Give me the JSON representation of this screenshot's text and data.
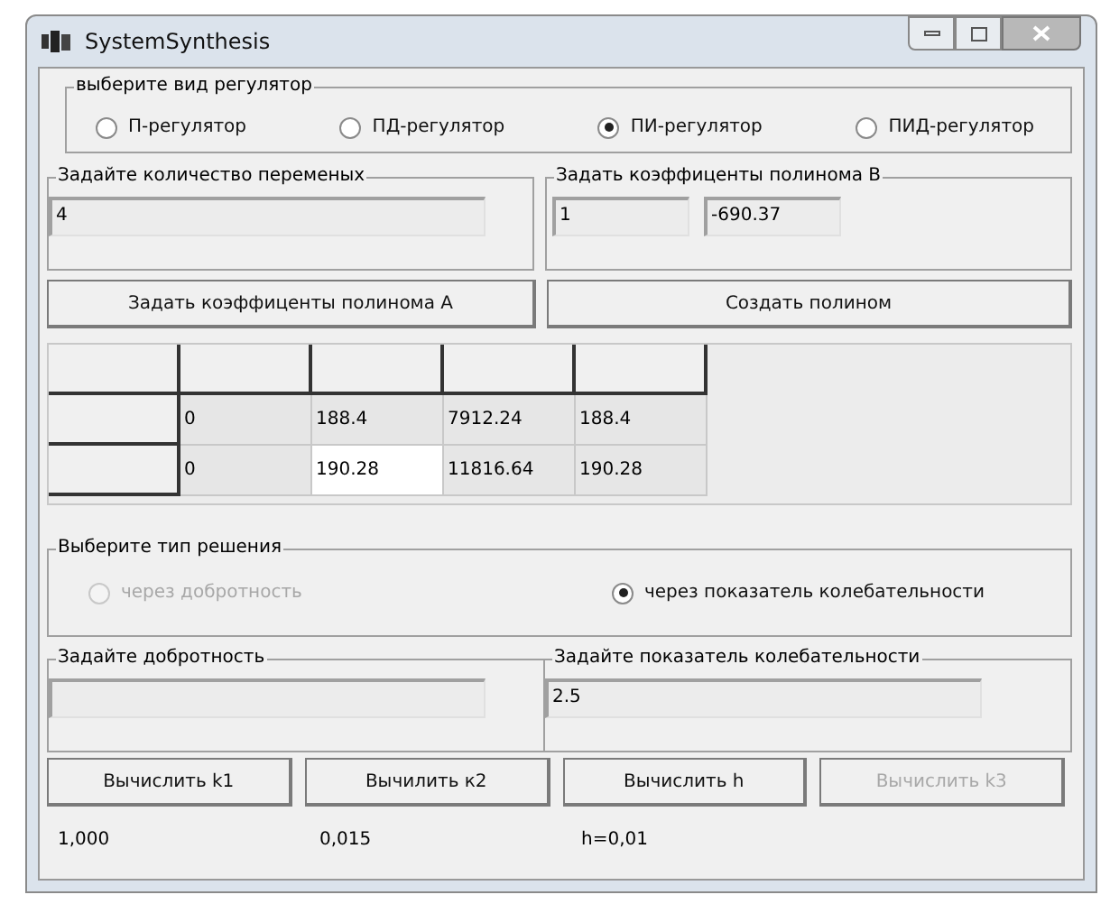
{
  "window": {
    "title": "SystemSynthesis"
  },
  "regulator": {
    "legend": "выберите вид регулятор",
    "options": [
      {
        "label": "П-регулятор",
        "selected": false
      },
      {
        "label": "ПД-регулятор",
        "selected": false
      },
      {
        "label": "ПИ-регулятор",
        "selected": true
      },
      {
        "label": "ПИД-регулятор",
        "selected": false
      }
    ]
  },
  "variables": {
    "legend": "Задайте количество переменых",
    "value": "4"
  },
  "poly_b": {
    "legend": "Задать коэффиценты полинома B",
    "values": [
      "1",
      "-690.37"
    ]
  },
  "top_buttons": [
    "Задать коэффиценты полинома A",
    "Создать полином"
  ],
  "table": {
    "rows": [
      {
        "cells": [
          {
            "text": "0",
            "selected": false
          },
          {
            "text": "188.4",
            "selected": false
          },
          {
            "text": "7912.24",
            "selected": false
          },
          {
            "text": "188.4",
            "selected": false
          }
        ]
      },
      {
        "cells": [
          {
            "text": "0",
            "selected": false
          },
          {
            "text": "190.28",
            "selected": true
          },
          {
            "text": "11816.64",
            "selected": false
          },
          {
            "text": "190.28",
            "selected": false
          }
        ]
      }
    ]
  },
  "solution": {
    "legend": "Выберите тип решения",
    "options": [
      {
        "label": "через добротность",
        "selected": false,
        "disabled": true
      },
      {
        "label": "через показатель колебательности",
        "selected": true,
        "disabled": false
      }
    ]
  },
  "quality": {
    "legend": "Задайте добротность"
  },
  "oscillation": {
    "legend": "Задайте показатель колебательности",
    "value": "2.5"
  },
  "buttons": [
    {
      "label": "Вычислить k1",
      "disabled": false
    },
    {
      "label": "Вычилить к2",
      "disabled": false
    },
    {
      "label": "Вычислить h",
      "disabled": false
    },
    {
      "label": "Вычислить k3",
      "disabled": true
    }
  ],
  "results": [
    "1,000",
    "0,015",
    "h=0,01"
  ]
}
